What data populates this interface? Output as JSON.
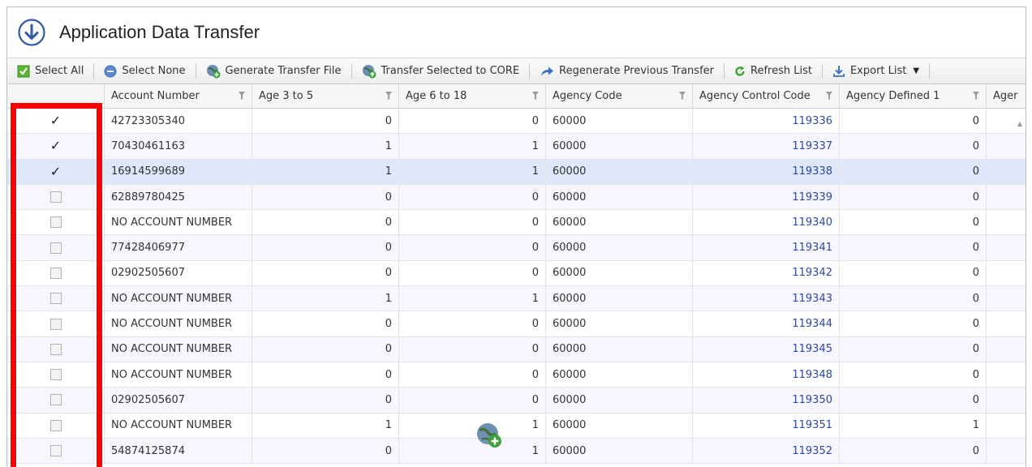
{
  "window": {
    "title": "Application Data Transfer"
  },
  "toolbar": {
    "select_all": "Select All",
    "select_none": "Select None",
    "generate_transfer_file": "Generate Transfer File",
    "transfer_selected": "Transfer Selected to CORE",
    "regenerate_previous": "Regenerate Previous Transfer",
    "refresh_list": "Refresh List",
    "export_list": "Export List"
  },
  "grid": {
    "columns": [
      "Account Number",
      "Age 3 to 5",
      "Age 6 to 18",
      "Agency Code",
      "Agency Control Code",
      "Agency Defined 1",
      "Ager"
    ],
    "rows": [
      {
        "checked": true,
        "account": "42723305340",
        "age35": "0",
        "age618": "0",
        "agency": "60000",
        "control": "119336",
        "defined1": "0"
      },
      {
        "checked": true,
        "account": "70430461163",
        "age35": "1",
        "age618": "1",
        "agency": "60000",
        "control": "119337",
        "defined1": "0"
      },
      {
        "checked": true,
        "account": "16914599689",
        "age35": "1",
        "age618": "1",
        "agency": "60000",
        "control": "119338",
        "defined1": "0"
      },
      {
        "checked": false,
        "account": "62889780425",
        "age35": "0",
        "age618": "0",
        "agency": "60000",
        "control": "119339",
        "defined1": "0"
      },
      {
        "checked": false,
        "account": "NO ACCOUNT NUMBER",
        "age35": "0",
        "age618": "0",
        "agency": "60000",
        "control": "119340",
        "defined1": "0"
      },
      {
        "checked": false,
        "account": "77428406977",
        "age35": "0",
        "age618": "0",
        "agency": "60000",
        "control": "119341",
        "defined1": "0"
      },
      {
        "checked": false,
        "account": "02902505607",
        "age35": "0",
        "age618": "0",
        "agency": "60000",
        "control": "119342",
        "defined1": "0"
      },
      {
        "checked": false,
        "account": "NO ACCOUNT NUMBER",
        "age35": "1",
        "age618": "1",
        "agency": "60000",
        "control": "119343",
        "defined1": "0"
      },
      {
        "checked": false,
        "account": "NO ACCOUNT NUMBER",
        "age35": "0",
        "age618": "0",
        "agency": "60000",
        "control": "119344",
        "defined1": "0"
      },
      {
        "checked": false,
        "account": "NO ACCOUNT NUMBER",
        "age35": "0",
        "age618": "0",
        "agency": "60000",
        "control": "119345",
        "defined1": "0"
      },
      {
        "checked": false,
        "account": "NO ACCOUNT NUMBER",
        "age35": "0",
        "age618": "0",
        "agency": "60000",
        "control": "119348",
        "defined1": "0"
      },
      {
        "checked": false,
        "account": "02902505607",
        "age35": "0",
        "age618": "0",
        "agency": "60000",
        "control": "119350",
        "defined1": "0"
      },
      {
        "checked": false,
        "account": "NO ACCOUNT NUMBER",
        "age35": "1",
        "age618": "1",
        "agency": "60000",
        "control": "119351",
        "defined1": "1"
      },
      {
        "checked": false,
        "account": "54874125874",
        "age35": "0",
        "age618": "1",
        "agency": "60000",
        "control": "119352",
        "defined1": "0"
      }
    ]
  },
  "colors": {
    "highlight_border": "#ff0000",
    "selected_row": "#dfe7fa",
    "alt_row": "#f7f5fd",
    "link": "#2b4aa0"
  },
  "icons": {
    "title": "download-circle-icon",
    "select_all": "checkbox-checked-icon",
    "select_none": "minus-circle-icon",
    "generate": "globe-add-icon",
    "transfer": "globe-upload-icon",
    "regenerate": "redo-arrow-icon",
    "refresh": "refresh-icon",
    "export": "download-tray-icon"
  }
}
